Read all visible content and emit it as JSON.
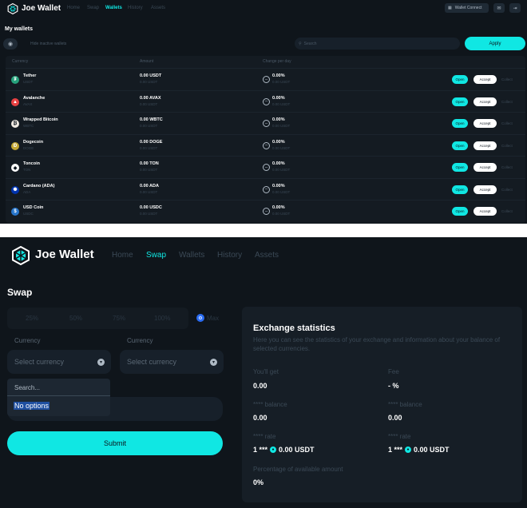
{
  "top": {
    "brand": "Joe Wallet",
    "nav": [
      "Home",
      "Swap",
      "Wallets",
      "History",
      "Assets"
    ],
    "active_nav": "Wallets",
    "wallet_connect": "Wallet Connect",
    "title": "My wallets",
    "hide_inactive": "Hide inactive wallets",
    "search_placeholder": "Search",
    "apply": "Apply",
    "columns": [
      "Currency",
      "Amount",
      "Change per day"
    ],
    "actions": {
      "open": "Open",
      "accept": "Accept",
      "collect": "Collect"
    },
    "rows": [
      {
        "name": "Tether",
        "sub": "USDT",
        "amount": "0.00 USDT",
        "amount_sub": "0.00 USDT",
        "change": "0.00%",
        "change_sub": "0.00 USDT",
        "color": "#26a17b",
        "icon": "tether-icon"
      },
      {
        "name": "Avalanche",
        "sub": "AVAX",
        "amount": "0.00 AVAX",
        "amount_sub": "0.00 USDT",
        "change": "0.00%",
        "change_sub": "0.00 USDT",
        "color": "#e84142",
        "icon": "avalanche-icon"
      },
      {
        "name": "Wrapped Bitcoin",
        "sub": "WBTC",
        "amount": "0.00 WBTC",
        "amount_sub": "0.00 USDT",
        "change": "0.00%",
        "change_sub": "0.00 USDT",
        "color": "#f0eae2",
        "icon": "wbtc-icon"
      },
      {
        "name": "Dogecoin",
        "sub": "DOGE",
        "amount": "0.00 DOGE",
        "amount_sub": "0.00 USDT",
        "change": "0.00%",
        "change_sub": "0.00 USDT",
        "color": "#c2a633",
        "icon": "doge-icon"
      },
      {
        "name": "Toncoin",
        "sub": "TON",
        "amount": "0.00 TON",
        "amount_sub": "0.00 USDT",
        "change": "0.00%",
        "change_sub": "0.00 USDT",
        "color": "#ffffff",
        "icon": "ton-icon"
      },
      {
        "name": "Cardano (ADA)",
        "sub": "ADA",
        "amount": "0.00 ADA",
        "amount_sub": "0.00 USDT",
        "change": "0.00%",
        "change_sub": "0.00 USDT",
        "color": "#0033ad",
        "icon": "cardano-icon"
      },
      {
        "name": "USD Coin",
        "sub": "USDC",
        "amount": "0.00 USDC",
        "amount_sub": "0.00 USDT",
        "change": "0.00%",
        "change_sub": "0.00 USDT",
        "color": "#2775ca",
        "icon": "usdc-icon"
      }
    ]
  },
  "bottom": {
    "brand": "Joe Wallet",
    "nav": [
      "Home",
      "Swap",
      "Wallets",
      "History",
      "Assets"
    ],
    "active_nav": "Swap",
    "title": "Swap",
    "percents": [
      "25%",
      "50%",
      "75%",
      "100%"
    ],
    "max_label": "Max",
    "currency_label": "Currency",
    "select_placeholder": "Select currency",
    "dropdown_search": "Search...",
    "no_options": "No options",
    "submit": "Submit",
    "stats": {
      "title": "Exchange statistics",
      "desc": "Here you can see the statistics of your exchange and information about your balance of selected currencies.",
      "youll_get_label": "You'll get",
      "youll_get": "0.00",
      "fee_label": "Fee",
      "fee": "- %",
      "balance_label": "**** balance",
      "balance_left": "0.00",
      "balance_right": "0.00",
      "rate_label": "**** rate",
      "rate_left_prefix": "1 ***",
      "rate_left_value": "0.00 USDT",
      "rate_right_prefix": "1 ***",
      "rate_right_value": "0.00 USDT",
      "pct_label": "Percentage of available amount",
      "pct_value": "0%"
    }
  },
  "colors": {
    "accent": "#10e7e3",
    "bg": "#0f151b"
  }
}
